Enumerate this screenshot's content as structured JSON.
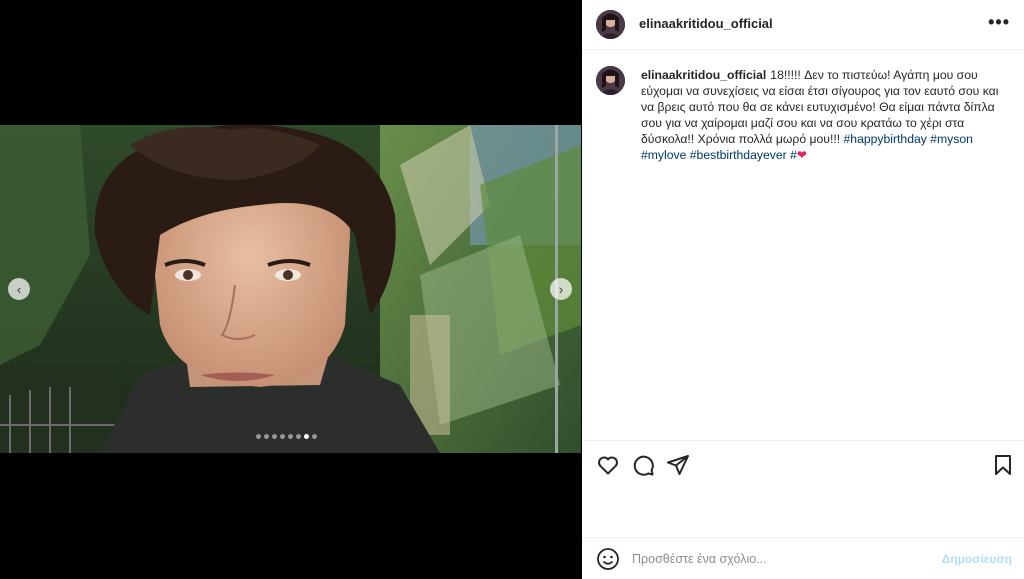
{
  "post": {
    "username": "elinaakritidou_official",
    "more_icon": "more-horizontal-icon",
    "caption": {
      "username": "elinaakritidou_official",
      "text": "18!!!!! Δεν το πιστεύω! Αγάπη μου σου εύχομαι να συνεχίσεις να είσαι έτσι σίγουρος για τον εαυτό σου και να βρεις αυτό που θα σε κάνει ευτυχισμένο! Θα είμαι πάντα δίπλα σου για να χαίρομαι μαζί σου και να σου κρατάω το χέρι στα δύσκολα!! Χρόνια πολλά μωρό μου!!!",
      "hashtags": [
        "#happybirthday",
        "#myson",
        "#mylove",
        "#bestbirthdayever"
      ],
      "tail_hash": "#",
      "emoji": "❤"
    }
  },
  "carousel": {
    "prev_icon": "‹",
    "next_icon": "›",
    "total_slides": 8,
    "active_slide": 7
  },
  "actions": {
    "like_icon": "heart-icon",
    "comment_icon": "comment-icon",
    "share_icon": "send-icon",
    "save_icon": "bookmark-icon"
  },
  "comment": {
    "placeholder": "Προσθέστε ένα σχόλιο...",
    "post_label": "Δημοσίευση",
    "emoji_icon": "smiley-icon"
  },
  "colors": {
    "link": "#00376b",
    "post_button_disabled": "#b2dffc",
    "text": "#262626",
    "border": "#efefef"
  }
}
